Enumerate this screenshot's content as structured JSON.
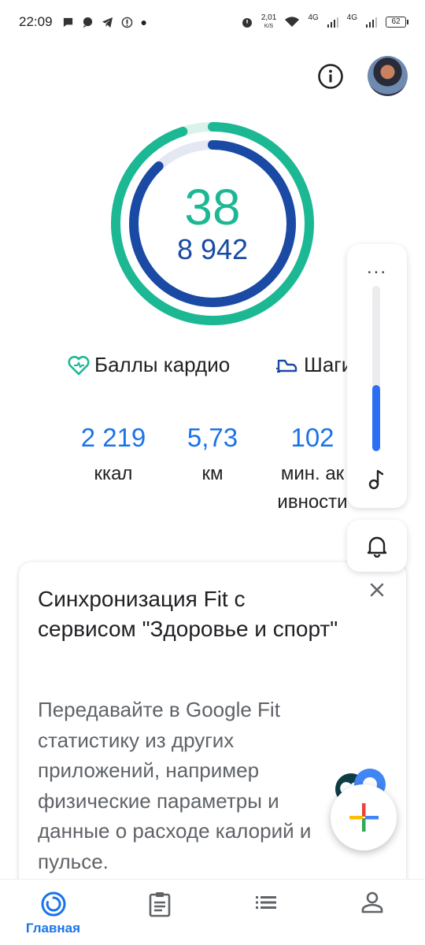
{
  "status_bar": {
    "time": "22:09",
    "speed_value": "2,01",
    "speed_unit": "K/S",
    "network_1": "4G",
    "network_2": "4G",
    "battery": "62"
  },
  "ring": {
    "heart_points": "38",
    "steps": "8 942",
    "heart_progress": 0.95,
    "steps_progress": 0.88,
    "colors": {
      "heart": "#1bb893",
      "steps": "#1a4aa4",
      "heart_track": "#d9f3ec",
      "steps_track": "#e3e8f3"
    }
  },
  "legend": {
    "cardio_label": "Баллы кардио",
    "steps_label": "Шаги"
  },
  "stats": [
    {
      "value": "2 219",
      "label": "ккал"
    },
    {
      "value": "5,73",
      "label": "км"
    },
    {
      "value": "102",
      "label_line1": "мин. ак",
      "label_line2": "ивности"
    }
  ],
  "floating_panel": {
    "menu": "...",
    "volume_level": 0.4
  },
  "card": {
    "title": "Синхронизация Fit с сервисом \"Здоровье и спорт\"",
    "body": "Передавайте в Google Fit статистику из других приложений, например физические параметры и данные о расходе калорий и пульсе."
  },
  "bottom_nav": {
    "home_label": "Главная",
    "active_color": "#1a73e8"
  }
}
